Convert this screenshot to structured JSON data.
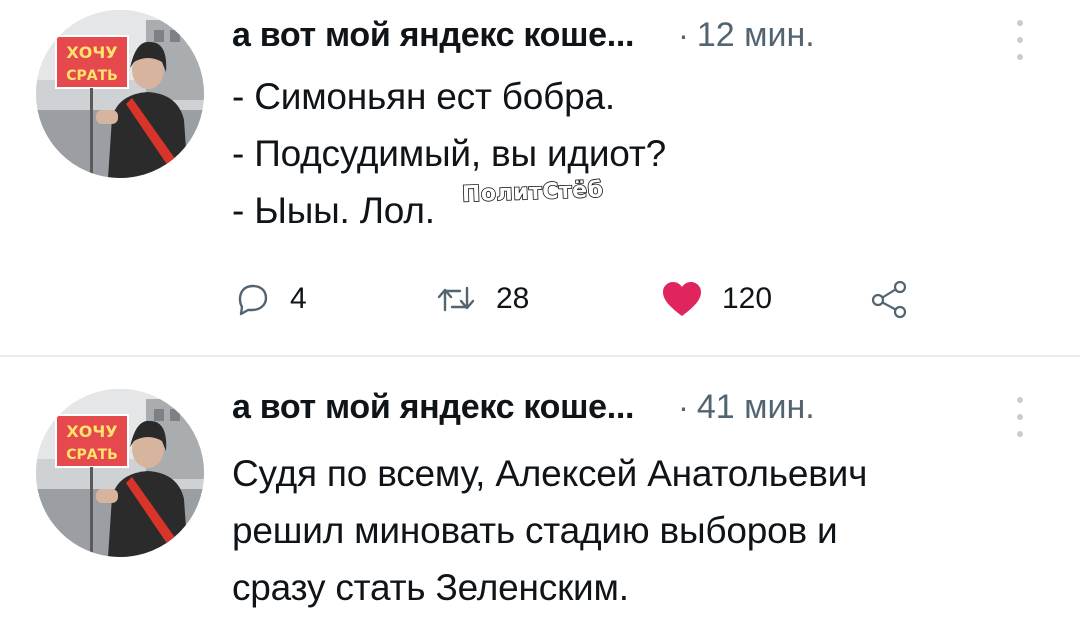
{
  "tweets": [
    {
      "author": "а вот мой яндекс коше...",
      "separator": "·",
      "time": "12 мин.",
      "avatar": {
        "sign_text_1": "ХОЧУ",
        "sign_text_2": "СРАТЬ"
      },
      "body": "- Симоньян ест бобра.\n- Подсудимый, вы идиот?\n- Ыыы. Лол.",
      "watermark": "ПолитСтёб",
      "actions": {
        "replies": "4",
        "retweets": "28",
        "likes": "120"
      }
    },
    {
      "author": "а вот мой яндекс коше...",
      "separator": "·",
      "time": "41 мин.",
      "avatar": {
        "sign_text_1": "ХОЧУ",
        "sign_text_2": "СРАТЬ"
      },
      "body": "Судя по всему, Алексей Анатольевич\nрешил миновать стадию выборов и\nсразу стать Зеленским."
    }
  ],
  "icons": {
    "reply": "reply-icon",
    "retweet": "retweet-icon",
    "like": "heart-icon",
    "share": "share-icon",
    "menu": "more-vertical-icon"
  },
  "colors": {
    "like": "#e0245e",
    "muted": "#536471",
    "text": "#0f1419",
    "divider": "#e6ecf0"
  }
}
